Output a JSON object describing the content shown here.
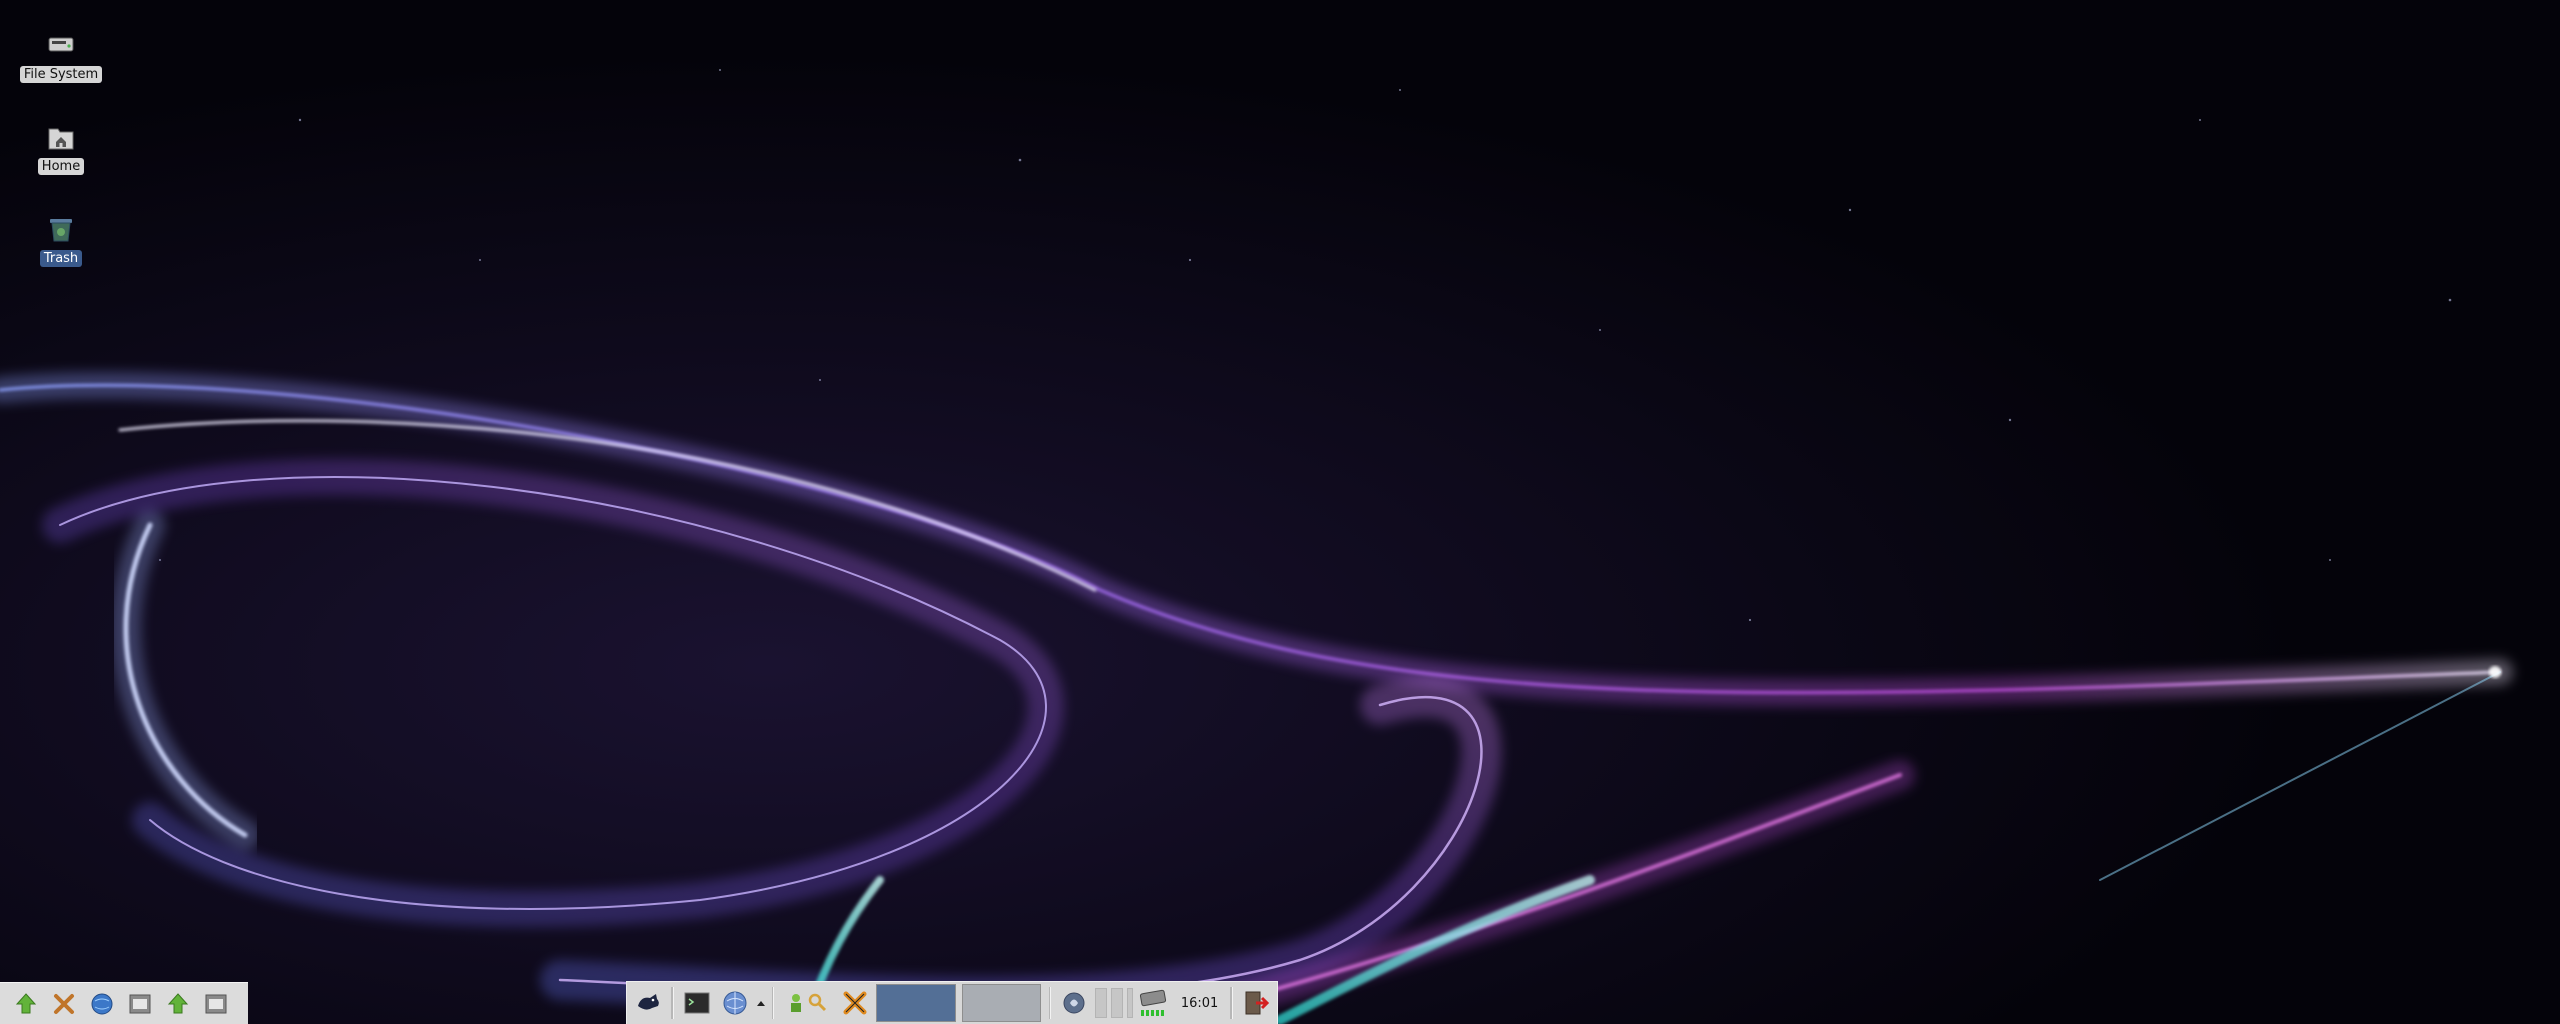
{
  "desktop": {
    "icons": [
      {
        "label": "File System",
        "icon": "drive-icon"
      },
      {
        "label": "Home",
        "icon": "home-folder-icon"
      },
      {
        "label": "Trash",
        "icon": "trash-icon",
        "selected": true
      }
    ]
  },
  "launcher": {
    "items": [
      "up-arrow-icon",
      "close-x-icon",
      "globe-icon",
      "text-editor-icon",
      "up-arrow-icon",
      "text-editor-icon"
    ]
  },
  "panel": {
    "apps": [
      "mouse-menu-icon",
      "terminal-icon",
      "web-browser-icon"
    ],
    "workspaces": [
      {
        "name": "workspace-1",
        "active": true
      },
      {
        "name": "workspace-2",
        "active": false
      }
    ],
    "clock": "16:01",
    "tray": [
      "network-icon",
      "battery-icon",
      "logout-icon"
    ]
  },
  "colors": {
    "panel_bg": "#d8d8d8",
    "workspace_active": "#536f96",
    "workspace_inactive": "#a9adb3",
    "wallpaper_bg": "#04030a",
    "wallpaper_accent": "#9b5cf0"
  }
}
